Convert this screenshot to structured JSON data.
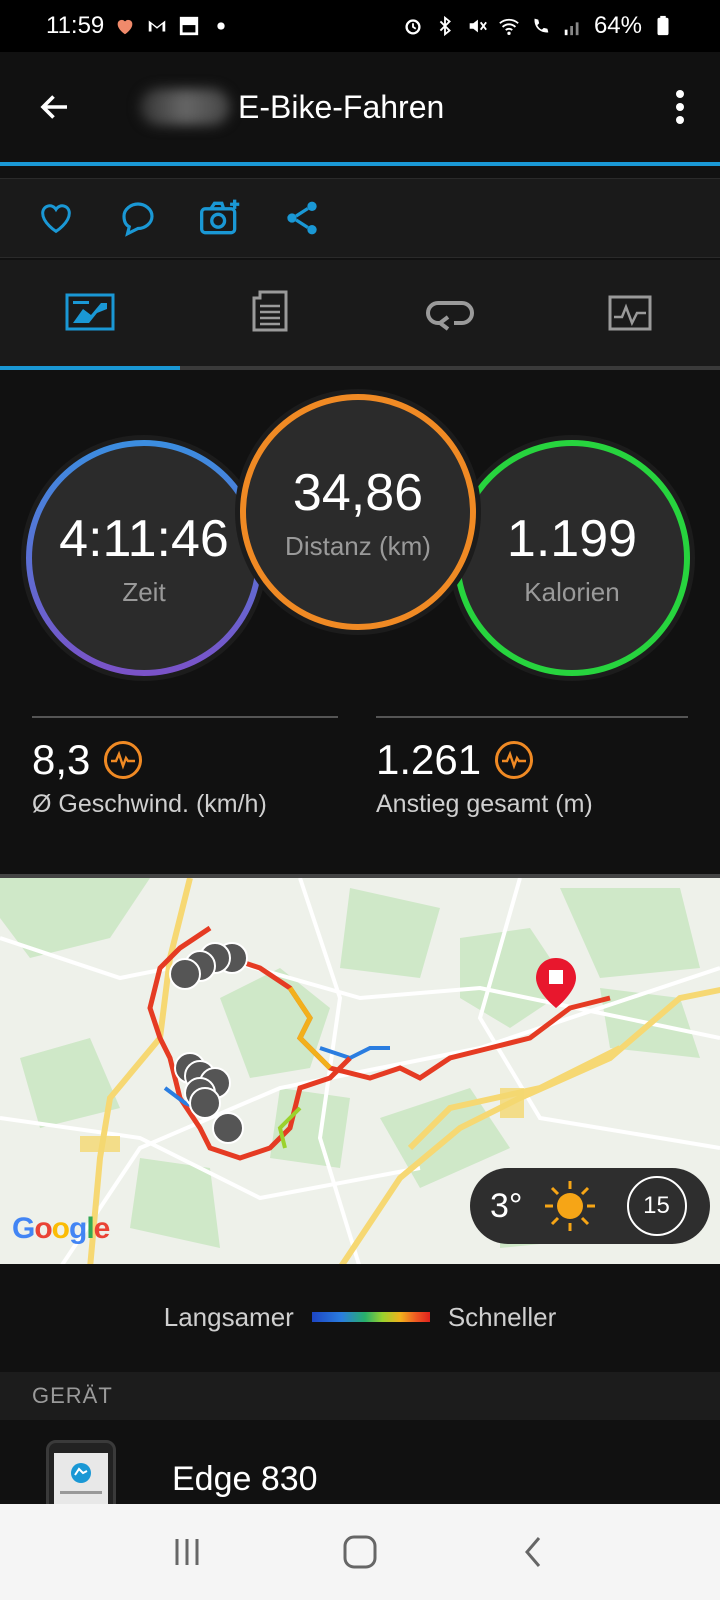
{
  "status_bar": {
    "time": "11:59",
    "battery": "64%"
  },
  "header": {
    "title": "E-Bike-Fahren"
  },
  "tabs": [
    "overview",
    "details",
    "laps",
    "charts"
  ],
  "stats": {
    "time": {
      "value": "4:11:46",
      "label": "Zeit"
    },
    "distance": {
      "value": "34,86",
      "label": "Distanz (km)"
    },
    "calories": {
      "value": "1.199",
      "label": "Kalorien"
    },
    "avg_speed": {
      "value": "8,3",
      "label": "Ø Geschwind. (km/h)"
    },
    "ascent": {
      "value": "1.261",
      "label": "Anstieg gesamt (m)"
    }
  },
  "map": {
    "temperature": "3°",
    "wind": "15",
    "google": "Google"
  },
  "legend": {
    "slower": "Langsamer",
    "faster": "Schneller"
  },
  "device_section": {
    "header": "GERÄT",
    "device_name": "Edge 830"
  },
  "colors": {
    "accent": "#1a98d5",
    "distance_ring": "#f08a24",
    "calories_ring": "#27d43e",
    "time_ring": "#3b8ee0"
  }
}
